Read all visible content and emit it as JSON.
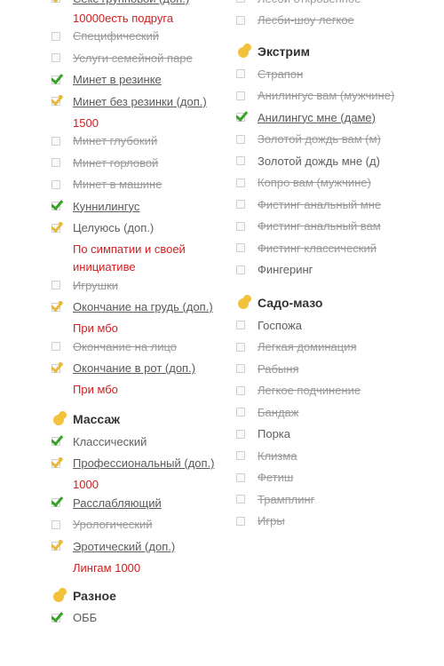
{
  "left_column": {
    "top_items": [
      {
        "label": "Секс групповой (доп.)",
        "state": "paid",
        "style": "link"
      },
      {
        "note": "10000есть подруга"
      },
      {
        "label": "Специфический",
        "state": "unchecked",
        "style": "strike"
      },
      {
        "label": "Услуги семейной паре",
        "state": "unchecked",
        "style": "strike"
      },
      {
        "label": "Минет в резинке",
        "state": "checked",
        "style": "link"
      },
      {
        "label": "Минет без резинки (доп.)",
        "state": "paid",
        "style": "link"
      },
      {
        "note": "1500"
      },
      {
        "label": "Минет глубокий",
        "state": "unchecked",
        "style": "strike"
      },
      {
        "label": "Минет горловой",
        "state": "unchecked",
        "style": "strike"
      },
      {
        "label": "Минет в машине",
        "state": "unchecked",
        "style": "strike"
      },
      {
        "label": "Куннилингус",
        "state": "checked",
        "style": "link"
      },
      {
        "label": "Целуюсь (доп.)",
        "state": "paid",
        "style": "plain"
      },
      {
        "note": "По симпатии и своей"
      },
      {
        "note": "инициативе"
      },
      {
        "label": "Игрушки",
        "state": "unchecked",
        "style": "strike"
      },
      {
        "label": "Окончание на грудь (доп.)",
        "state": "paid",
        "style": "link"
      },
      {
        "note": "При мбо"
      },
      {
        "label": "Окончание на лицо",
        "state": "unchecked",
        "style": "strike"
      },
      {
        "label": "Окончание в рот (доп.)",
        "state": "paid",
        "style": "link"
      },
      {
        "note": "При мбо"
      }
    ],
    "massage": {
      "title": "Массаж",
      "items": [
        {
          "label": "Классический",
          "state": "checked",
          "style": "plain"
        },
        {
          "label": "Профессиональный (доп.)",
          "state": "paid",
          "style": "link"
        },
        {
          "note": "1000"
        },
        {
          "label": "Расслабляющий",
          "state": "checked",
          "style": "link"
        },
        {
          "label": "Урологический",
          "state": "unchecked",
          "style": "strike"
        },
        {
          "label": "Эротический (доп.)",
          "state": "paid",
          "style": "link"
        },
        {
          "note": "Лингам 1000"
        }
      ]
    },
    "misc": {
      "title": "Разное",
      "items": [
        {
          "label": "ОББ",
          "state": "checked",
          "style": "plain"
        }
      ]
    }
  },
  "right_column": {
    "top_items": [
      {
        "label": "Лесби откровенное",
        "state": "unchecked",
        "style": "strike"
      },
      {
        "label": "Лесби-шоу легкое",
        "state": "unchecked",
        "style": "strike"
      }
    ],
    "extreme": {
      "title": "Экстрим",
      "items": [
        {
          "label": "Страпон",
          "state": "unchecked",
          "style": "strike"
        },
        {
          "label": "Анилингус вам (мужчине)",
          "state": "unchecked",
          "style": "strike"
        },
        {
          "label": "Анилингус мне (даме)",
          "state": "checked",
          "style": "link"
        },
        {
          "label": "Золотой дождь вам (м)",
          "state": "unchecked",
          "style": "strike"
        },
        {
          "label": "Золотой дождь мне (д)",
          "state": "unchecked",
          "style": "plain"
        },
        {
          "label": "Копро вам (мужчине)",
          "state": "unchecked",
          "style": "strike"
        },
        {
          "label": "Фистинг анальный мне",
          "state": "unchecked",
          "style": "strike"
        },
        {
          "label": "Фистинг анальный вам",
          "state": "unchecked",
          "style": "strike"
        },
        {
          "label": "Фистинг классический",
          "state": "unchecked",
          "style": "strike"
        },
        {
          "label": "Фингеринг",
          "state": "unchecked",
          "style": "plain"
        }
      ]
    },
    "sadomaso": {
      "title": "Садо-мазо",
      "items": [
        {
          "label": "Госпожа",
          "state": "unchecked",
          "style": "plain"
        },
        {
          "label": "Легкая доминация",
          "state": "unchecked",
          "style": "strike"
        },
        {
          "label": "Рабыня",
          "state": "unchecked",
          "style": "strike"
        },
        {
          "label": "Легкое подчинение",
          "state": "unchecked",
          "style": "strike"
        },
        {
          "label": "Бандаж",
          "state": "unchecked",
          "style": "strike"
        },
        {
          "label": "Порка",
          "state": "unchecked",
          "style": "plain"
        },
        {
          "label": "Клизма",
          "state": "unchecked",
          "style": "strike"
        },
        {
          "label": "Фетиш",
          "state": "unchecked",
          "style": "strike"
        },
        {
          "label": "Трамплинг",
          "state": "unchecked",
          "style": "strike"
        },
        {
          "label": "Игры",
          "state": "unchecked",
          "style": "strike"
        }
      ]
    }
  },
  "colors": {
    "check_green": "#3aa12b",
    "check_gold": "#e6b93a",
    "note_red": "#d02020"
  }
}
